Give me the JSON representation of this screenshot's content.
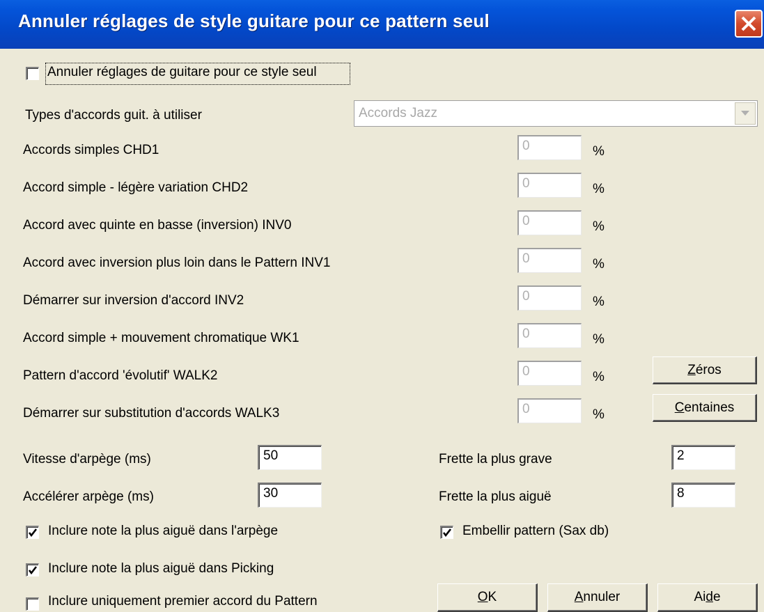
{
  "window": {
    "title": "Annuler réglages de style guitare pour ce pattern seul"
  },
  "override": {
    "label": "Annuler réglages de guitare pour ce style seul",
    "checked": false
  },
  "chord_types": {
    "label": "Types d'accords guit. à utiliser",
    "value": "Accords Jazz"
  },
  "percent_rows": [
    {
      "label": "Accords simples  CHD1",
      "value": "0",
      "unit": "%"
    },
    {
      "label": "Accord simple - légère variation   CHD2",
      "value": "0",
      "unit": "%"
    },
    {
      "label": "Accord avec quinte en basse (inversion)  INV0",
      "value": "0",
      "unit": "%"
    },
    {
      "label": "Accord avec inversion plus loin dans le Pattern  INV1",
      "value": "0",
      "unit": "%"
    },
    {
      "label": "Démarrer sur inversion d'accord  INV2",
      "value": "0",
      "unit": "%"
    },
    {
      "label": "Accord simple + mouvement chromatique  WK1",
      "value": "0",
      "unit": "%"
    },
    {
      "label": "Pattern d'accord 'évolutif'  WALK2",
      "value": "0",
      "unit": "%"
    },
    {
      "label": "Démarrer sur substitution d'accords  WALK3",
      "value": "0",
      "unit": "%"
    }
  ],
  "buttons": {
    "zeros": {
      "label": "Zéros",
      "mnemonic": "Z",
      "rest": "éros"
    },
    "hundreds": {
      "label": "Centaines",
      "mnemonic": "C",
      "rest": "entaines"
    },
    "ok": {
      "label": "OK",
      "mnemonic": "O",
      "rest": "K"
    },
    "cancel": {
      "label": "Annuler",
      "mnemonic": "A",
      "rest": "nnuler"
    },
    "help": {
      "label": "Aide",
      "pre": "Ai",
      "mnemonic": "d",
      "rest": "e"
    }
  },
  "arpeggio_speed": {
    "label": "Vitesse d'arpège (ms)",
    "value": "50"
  },
  "arpeggio_accel": {
    "label": "Accélérer arpège (ms)",
    "value": "30"
  },
  "lowest_fret": {
    "label": "Frette la plus grave",
    "value": "2"
  },
  "highest_fret": {
    "label": "Frette la plus aiguë",
    "value": "8"
  },
  "checks": {
    "top_note_arp": {
      "label": "Inclure note la plus aiguë dans l'arpège",
      "checked": true
    },
    "embellish": {
      "label": "Embellir pattern (Sax db)",
      "checked": true
    },
    "top_note_pick": {
      "label": "Inclure note la plus aiguë dans Picking",
      "checked": true
    },
    "first_chord_only": {
      "label": "Inclure uniquement premier accord du Pattern",
      "checked": false
    }
  }
}
